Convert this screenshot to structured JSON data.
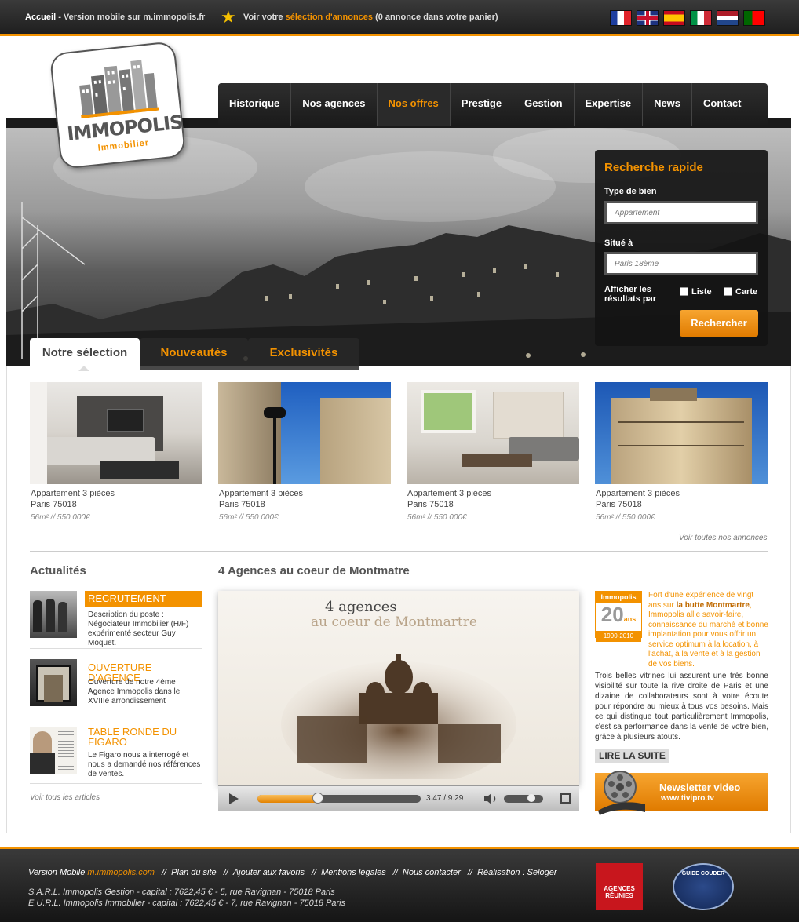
{
  "topbar": {
    "home": "Accueil",
    "mobile": " - Version mobile sur m.immopolis.fr",
    "selection_prefix": "Voir votre ",
    "selection_link": "sélection d'annonces",
    "selection_suffix": " (0 annonce dans votre panier)",
    "flags": [
      "french-flag",
      "english-flag",
      "spanish-flag",
      "italian-flag",
      "dutch-flag",
      "portuguese-flag"
    ]
  },
  "logo": {
    "name": "IMMOPOLIS",
    "sub": "Immobilier"
  },
  "nav": [
    "Historique",
    "Nos agences",
    "Nos offres",
    "Prestige",
    "Gestion",
    "Expertise",
    "News",
    "Contact"
  ],
  "nav_active": "Nos offres",
  "search": {
    "title": "Recherche rapide",
    "type_label": "Type de bien",
    "type_placeholder": "Appartement",
    "location_label": "Situé à",
    "location_placeholder": "Paris 18ème",
    "display_label_1": "Afficher les",
    "display_label_2": "résultats par",
    "opt_list": "Liste",
    "opt_map": "Carte",
    "button": "Rechercher"
  },
  "tabs": [
    "Notre sélection",
    "Nouveautés",
    "Exclusivités"
  ],
  "listings": [
    {
      "title": "Appartement 3 pièces",
      "city": "Paris 75018",
      "meta": "56m²  //  550 000€"
    },
    {
      "title": "Appartement 3 pièces",
      "city": "Paris 75018",
      "meta": "56m²  //  550 000€"
    },
    {
      "title": "Appartement 3 pièces",
      "city": "Paris 75018",
      "meta": "56m²  //  550 000€"
    },
    {
      "title": "Appartement 3 pièces",
      "city": "Paris 75018",
      "meta": "56m²  //  550 000€"
    }
  ],
  "see_all": "Voir toutes nos annonces",
  "news": {
    "heading": "Actualités",
    "items": [
      {
        "title": "RECRUTEMENT",
        "desc": "Description du poste : Négociateur Immobilier (H/F) expérimenté secteur Guy Moquet."
      },
      {
        "title": "OUVERTURE D'AGENCE",
        "desc": "Ouverture de notre 4ème Agence Immopolis dans le XVIIIe arrondissement"
      },
      {
        "title": "TABLE RONDE DU FIGARO",
        "desc": "Le Figaro nous a interrogé et nous a demandé nos références de ventes."
      }
    ],
    "see_all": "Voir tous les articles"
  },
  "agencies": {
    "heading": "4 Agences au coeur de Montmatre",
    "video_line1": "4 agences",
    "video_line2": "au coeur de Montmartre",
    "time": "3.47 / 9.29",
    "progress": 0.37,
    "volume": 0.7
  },
  "about": {
    "badge_top": "Immopolis",
    "badge_num": "20",
    "badge_ans": "ans",
    "badge_years": "1990-2010",
    "intro_a": "Fort d'une expérience de vingt ans sur ",
    "intro_b": "la butte Montmartre",
    "intro_c": ", Immopolis allie savoir-faire, connaissance du marché et bonne implantation pour vous offrir un service optimum à la location, à l'achat, à la vente et à la gestion de vos biens.",
    "body": "Trois belles vitrines lui assurent une très bonne visibilité sur toute la rive droite de Paris et une dizaine de collaborateurs sont à votre écoute pour répondre au mieux à tous vos besoins. Mais ce qui distingue tout particulièrement Immopolis, c'est sa performance dans la vente de votre bien, grâce à plusieurs atouts.",
    "read_more": "LIRE LA SUITE"
  },
  "newsletter": {
    "title": "Newsletter video",
    "site": "www.tivipro.tv"
  },
  "footer": {
    "mobile_prefix": "Version Mobile ",
    "mobile_link": "m.immopolis.com",
    "links": [
      "Plan du site",
      "Ajouter aux favoris",
      "Mentions légales",
      "Nous contacter",
      "Réalisation : Seloger"
    ],
    "legal1": "S.A.R.L. Immopolis Gestion - capital : 7622,45 € - 5, rue Ravignan - 75018 Paris",
    "legal2": "E.U.R.L. Immopolis Immobilier - capital : 7622,45 € - 7, rue Ravignan - 75018 Paris",
    "badge1": "AGENCES RÉUNIES",
    "badge2": "GUIDE COUDER"
  },
  "colors": {
    "accent": "#f39200",
    "dark": "#1f1f1f"
  }
}
